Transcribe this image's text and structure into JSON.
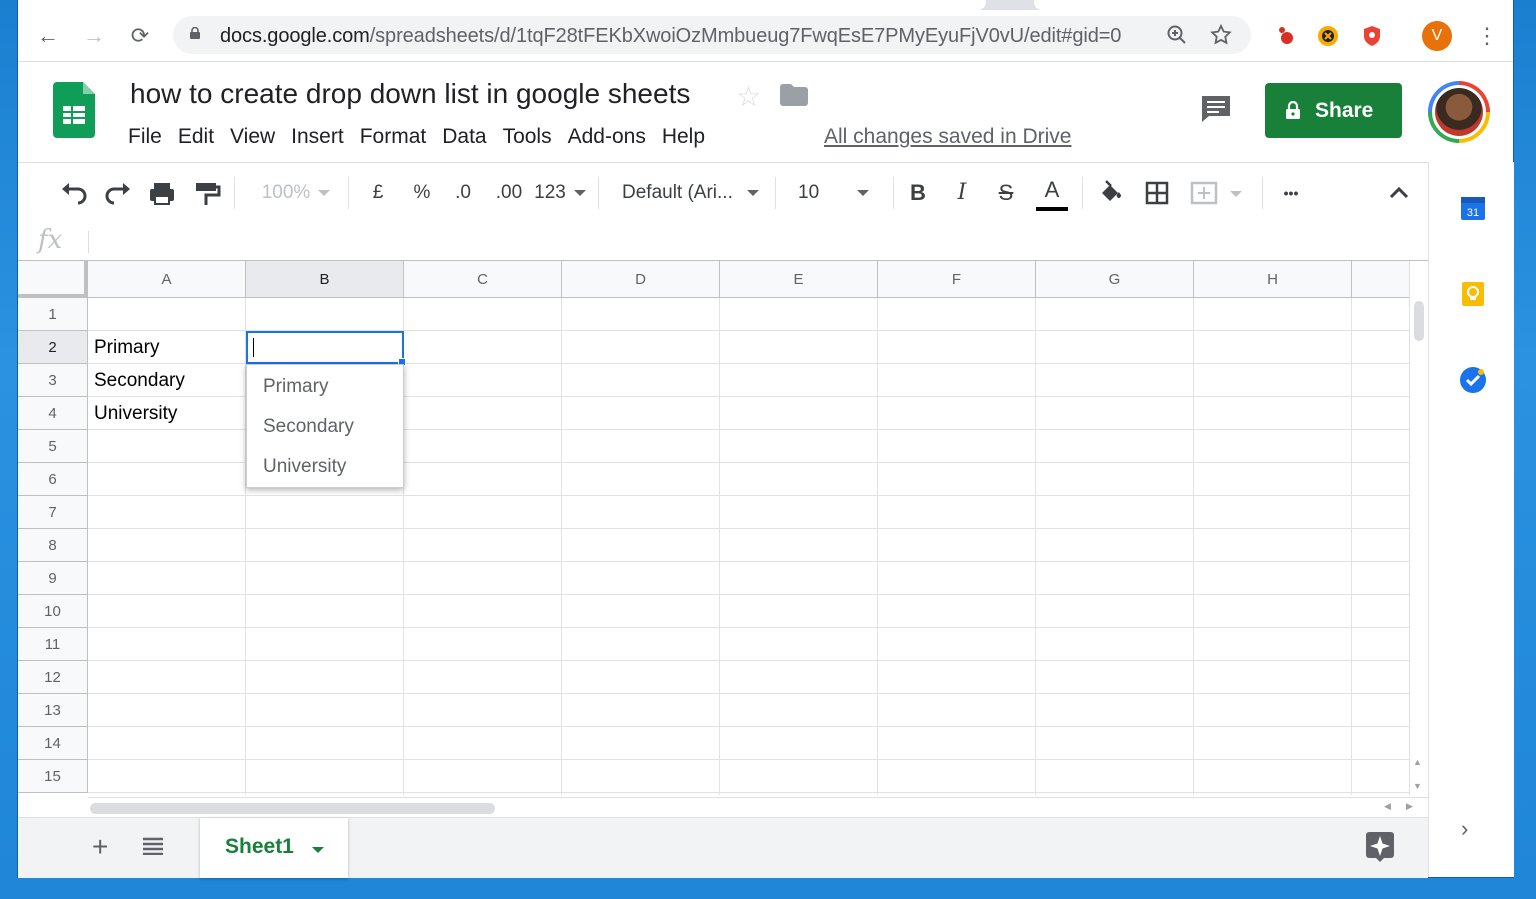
{
  "browser": {
    "url_host": "docs.google.com",
    "url_path": "/spreadsheets/d/1tqF28tFEKbXwoiOzMmbueug7FwqEsE7PMyEyuFjV0vU/edit#gid=0",
    "profile_initial": "V"
  },
  "doc": {
    "title": "how to create drop down list in google sheets",
    "save_status": "All changes saved in Drive",
    "share_label": "Share"
  },
  "menu": [
    "File",
    "Edit",
    "View",
    "Insert",
    "Format",
    "Data",
    "Tools",
    "Add-ons",
    "Help"
  ],
  "toolbar": {
    "zoom": "100%",
    "currency": "£",
    "percent": "%",
    "dec_less": ".0",
    "dec_more": ".00",
    "more_formats": "123",
    "font": "Default (Ari...",
    "font_size": "10",
    "bold": "B",
    "italic": "I",
    "strike": "S",
    "text_color": "A",
    "more": "•••"
  },
  "formula_bar": {
    "fx": "fx"
  },
  "grid": {
    "columns": [
      "A",
      "B",
      "C",
      "D",
      "E",
      "F",
      "G",
      "H"
    ],
    "rows": [
      "1",
      "2",
      "3",
      "4",
      "5",
      "6",
      "7",
      "8",
      "9",
      "10",
      "11",
      "12",
      "13",
      "14",
      "15"
    ],
    "cells": {
      "A2": "Primary",
      "A3": "Secondary",
      "A4": "University"
    },
    "active_cell": "B2"
  },
  "dropdown": {
    "options": [
      "Primary",
      "Secondary",
      "University"
    ]
  },
  "sheets": {
    "active_tab": "Sheet1"
  },
  "side_panel": {
    "calendar_day": "31"
  },
  "colors": {
    "accent_green": "#188038",
    "selection_blue": "#1a73e8"
  }
}
